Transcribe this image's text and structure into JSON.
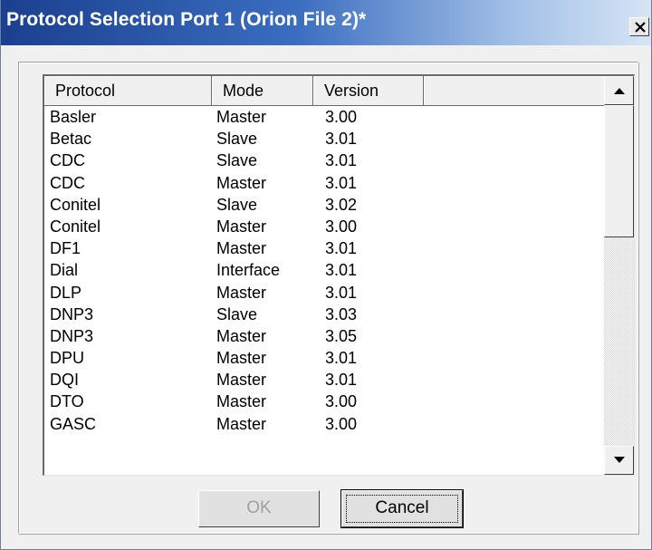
{
  "window": {
    "title": "Protocol Selection Port 1 (Orion File 2)*"
  },
  "list": {
    "columns": [
      "Protocol",
      "Mode",
      "Version",
      ""
    ],
    "rows": [
      {
        "protocol": "Basler",
        "mode": "Master",
        "version": "3.00"
      },
      {
        "protocol": "Betac",
        "mode": "Slave",
        "version": "3.01"
      },
      {
        "protocol": "CDC",
        "mode": "Slave",
        "version": "3.01"
      },
      {
        "protocol": "CDC",
        "mode": "Master",
        "version": "3.01"
      },
      {
        "protocol": "Conitel",
        "mode": "Slave",
        "version": "3.02"
      },
      {
        "protocol": "Conitel",
        "mode": "Master",
        "version": "3.00"
      },
      {
        "protocol": "DF1",
        "mode": "Master",
        "version": "3.01"
      },
      {
        "protocol": "Dial",
        "mode": "Interface",
        "version": "3.01"
      },
      {
        "protocol": "DLP",
        "mode": "Master",
        "version": "3.01"
      },
      {
        "protocol": "DNP3",
        "mode": "Slave",
        "version": "3.03"
      },
      {
        "protocol": "DNP3",
        "mode": "Master",
        "version": "3.05"
      },
      {
        "protocol": "DPU",
        "mode": "Master",
        "version": "3.01"
      },
      {
        "protocol": "DQI",
        "mode": "Master",
        "version": "3.01"
      },
      {
        "protocol": "DTO",
        "mode": "Master",
        "version": "3.00"
      },
      {
        "protocol": "GASC",
        "mode": "Master",
        "version": "3.00"
      }
    ]
  },
  "buttons": {
    "ok": "OK",
    "cancel": "Cancel"
  },
  "icons": {
    "close": "close-icon",
    "scroll_up": "arrow-up-icon",
    "scroll_down": "arrow-down-icon"
  },
  "colors": {
    "title_gradient_start": "#1b3f8f",
    "title_gradient_end": "#d6e4f5",
    "disabled_text": "#a0a0a0"
  }
}
